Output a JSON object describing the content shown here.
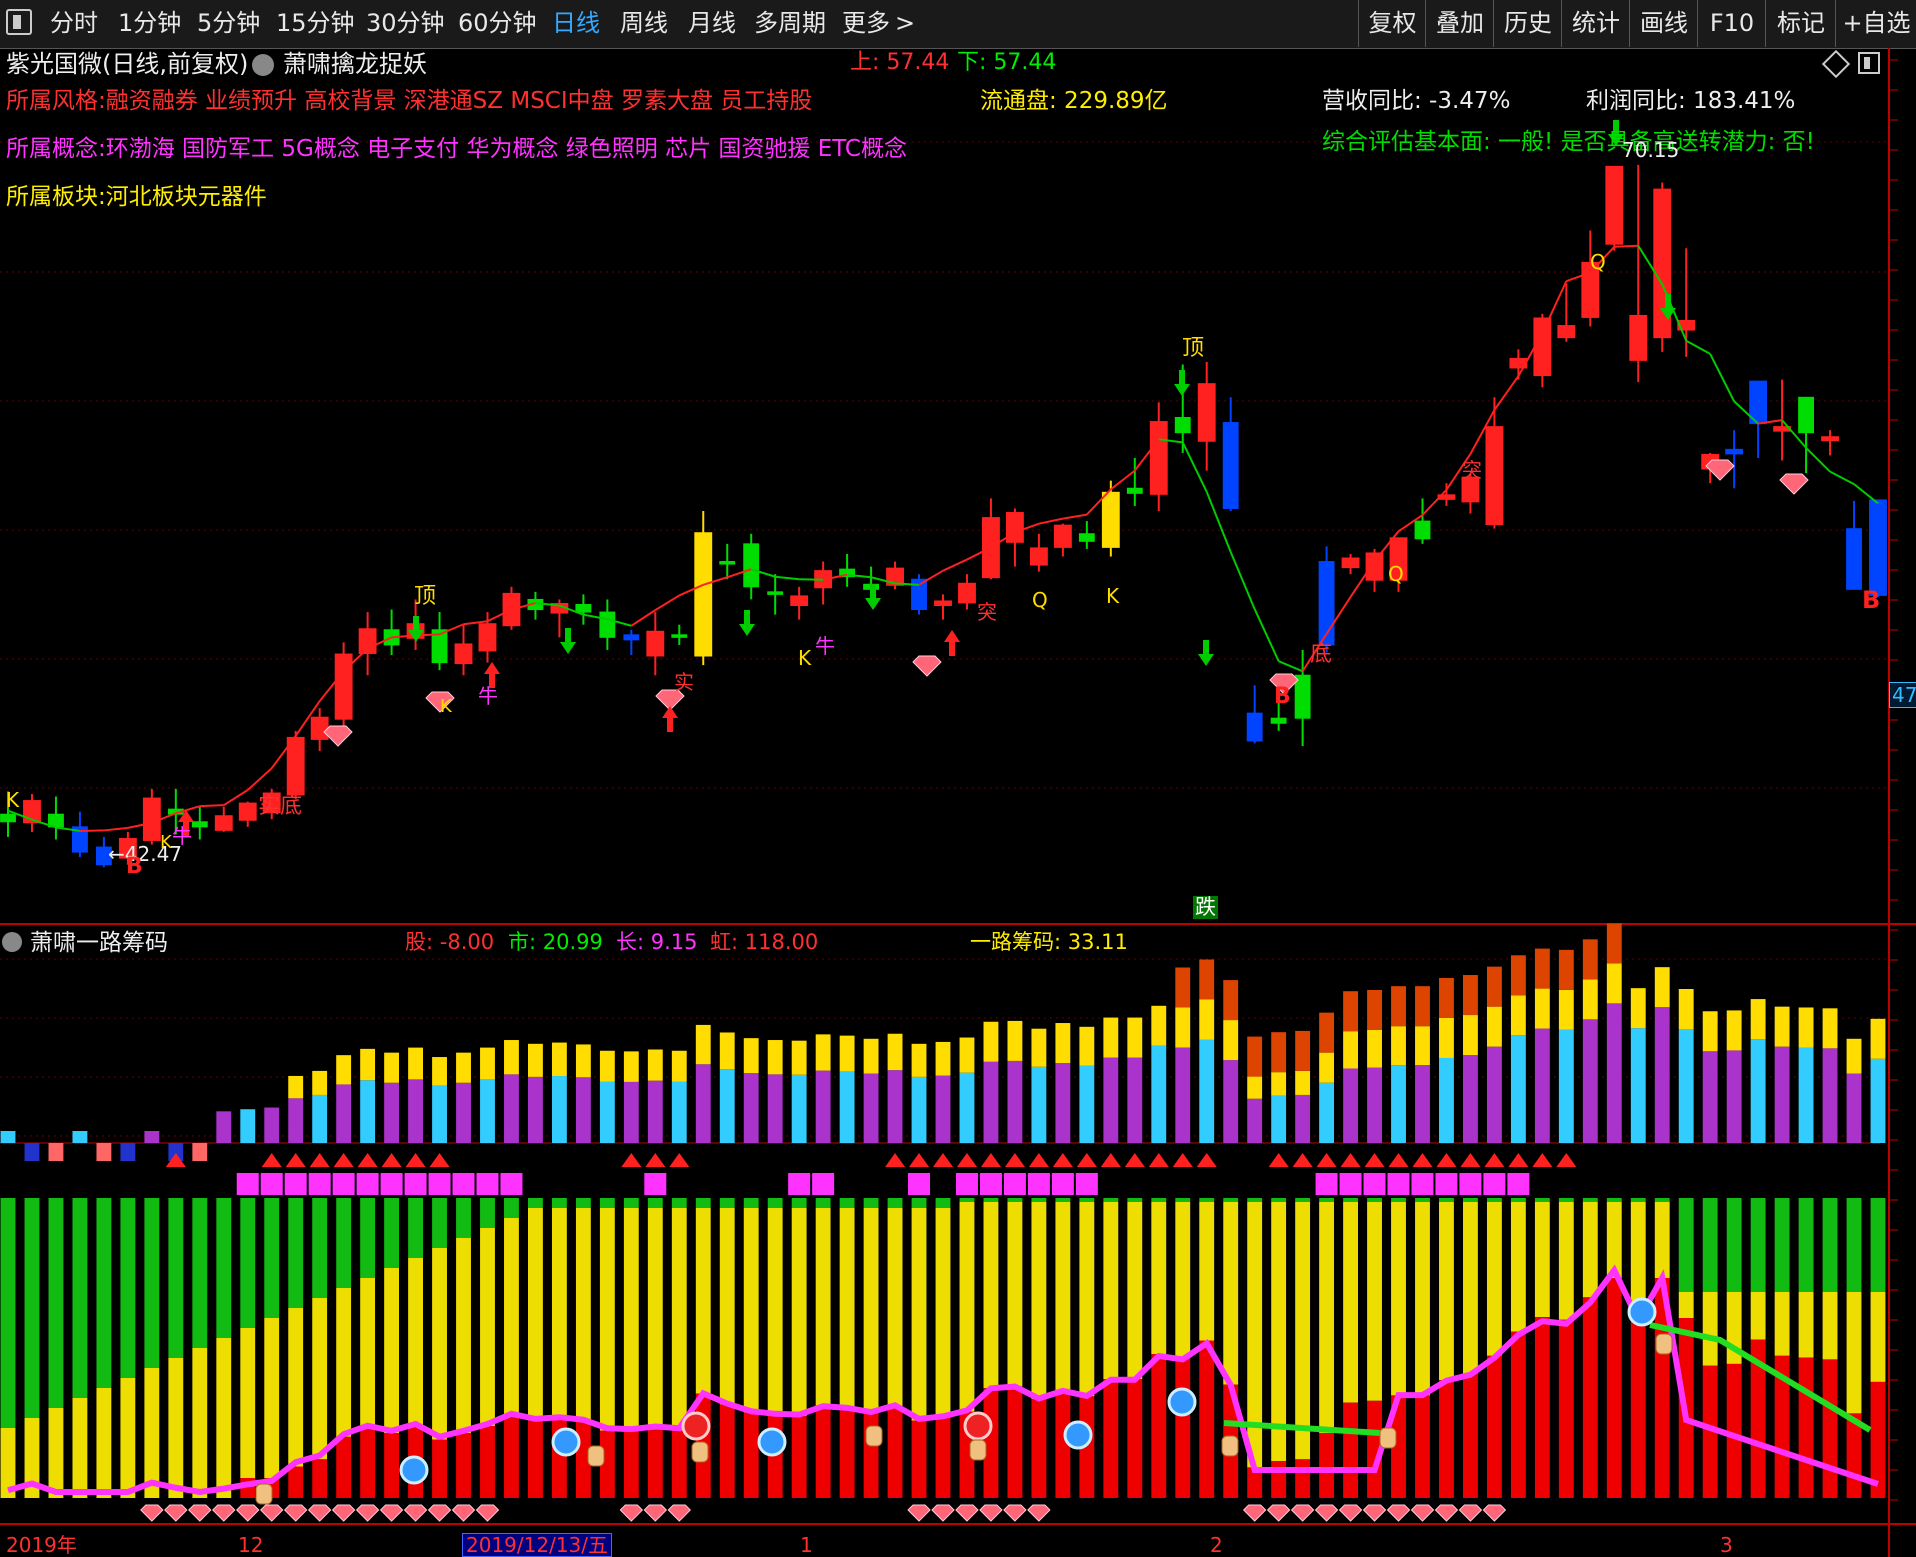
{
  "toolbar": {
    "menu_icon": "window-icon",
    "periods": [
      "分时",
      "1分钟",
      "5分钟",
      "15分钟",
      "30分钟",
      "60分钟",
      "日线",
      "周线",
      "月线",
      "多周期",
      "更多"
    ],
    "active_period": "日线",
    "more_arrow": ">",
    "right_buttons": [
      "复权",
      "叠加",
      "历史",
      "统计",
      "画线",
      "F10",
      "标记",
      "+自选"
    ]
  },
  "main_panel": {
    "title": "紫光国微(日线,前复权)",
    "indicator": "萧啸擒龙捉妖",
    "up_label": "上: 57.44",
    "down_label": "下: 57.44",
    "style_line": "所属风格:融资融券 业绩预升 高校背景 深港通SZ MSCI中盘 罗素大盘 员工持股",
    "concept_line": "所属概念:环渤海 国防军工 5G概念 电子支付 华为概念 绿色照明 芯片 国资驰援 ETC概念",
    "sector_line": "所属板块:河北板块元器件",
    "float_label": "流通盘: 229.89亿",
    "revenue_yoy": "营收同比: -3.47%",
    "profit_yoy": "利润同比: 183.41%",
    "assessment": "综合评估基本面: 一般! 是否具备高送转潜力: 否!",
    "price_high": "70.15",
    "price_low": "42.47",
    "price_axis_badge": "47",
    "fall_badge": "跌",
    "signal_labels": [
      "K",
      "实底",
      "K",
      "牛",
      "顶",
      "K",
      "牛",
      "实",
      "K",
      "牛",
      "突",
      "Q",
      "K",
      "顶",
      "底",
      "Q",
      "突",
      "Q",
      "B",
      "B",
      "B"
    ],
    "diamond_icon": "diamond-icon",
    "arrow_up_icon": "red-up-arrow-icon",
    "arrow_down_icon": "green-down-arrow-icon"
  },
  "sub_panel": {
    "indicator": "萧啸一路筹码",
    "stock_label": "股: -8.00",
    "market_label": "市: 20.99",
    "long_label": "长: 9.15",
    "rainbow_label": "虹: 118.00",
    "chip_label": "一路筹码: 33.11"
  },
  "time_axis": {
    "labels": [
      "2019年",
      "12",
      "2019/12/13/五",
      "1",
      "2",
      "3"
    ],
    "selected": "2019/12/13/五"
  },
  "colors": {
    "up": "#ff2020",
    "down_green": "#00dd00",
    "down_blue": "#0044ff",
    "yellow": "#ffdd00",
    "magenta": "#ff00ff",
    "cyan": "#33ccff",
    "purple": "#aa33cc",
    "axis": "#c00000"
  },
  "chart_data": {
    "type": "candlestick",
    "title": "紫光国微(日线,前复权)",
    "series": [
      {
        "name": "萧啸擒龙捉妖",
        "values": [
          [
            44.5,
            45.4,
            43.6,
            44.2
          ],
          [
            44.2,
            45.3,
            43.8,
            45.0
          ],
          [
            44.5,
            45.2,
            43.5,
            44.0
          ],
          [
            44.0,
            44.6,
            42.8,
            43.0
          ],
          [
            43.2,
            43.6,
            42.4,
            42.5
          ],
          [
            42.8,
            43.8,
            42.5,
            43.5
          ],
          [
            43.5,
            45.5,
            43.3,
            45.1
          ],
          [
            44.7,
            45.5,
            43.7,
            44.5
          ],
          [
            44.2,
            44.8,
            43.5,
            44.0
          ],
          [
            43.9,
            44.8,
            43.8,
            44.4
          ],
          [
            44.3,
            45.0,
            44.0,
            44.9
          ],
          [
            44.6,
            45.5,
            44.3,
            45.3
          ],
          [
            45.3,
            47.8,
            45.1,
            47.5
          ],
          [
            47.5,
            48.7,
            47.0,
            48.3
          ],
          [
            48.3,
            51.3,
            48.0,
            50.8
          ],
          [
            50.9,
            52.5,
            50.0,
            51.8
          ],
          [
            51.8,
            52.6,
            50.8,
            51.2
          ],
          [
            51.5,
            53.0,
            51.0,
            52.0
          ],
          [
            51.8,
            52.5,
            50.2,
            50.5
          ],
          [
            50.5,
            52.0,
            50.0,
            51.2
          ],
          [
            51.0,
            52.5,
            50.5,
            52.0
          ],
          [
            52.0,
            53.5,
            51.8,
            53.2
          ],
          [
            53.0,
            53.3,
            52.2,
            52.6
          ],
          [
            52.5,
            53.0,
            51.5,
            52.8
          ],
          [
            52.8,
            53.2,
            52.0,
            52.5
          ],
          [
            52.5,
            53.0,
            51.0,
            51.5
          ],
          [
            51.6,
            51.8,
            50.8,
            51.4
          ],
          [
            50.8,
            52.5,
            50.0,
            51.7
          ],
          [
            51.6,
            52.0,
            51.2,
            51.5
          ],
          [
            50.8,
            56.5,
            50.4,
            55.6
          ],
          [
            54.5,
            55.2,
            53.8,
            54.4
          ],
          [
            55.2,
            55.6,
            53.0,
            53.5
          ],
          [
            53.3,
            54.0,
            52.4,
            53.2
          ],
          [
            52.8,
            53.5,
            52.2,
            53.1
          ],
          [
            53.5,
            54.5,
            52.8,
            54.1
          ],
          [
            54.2,
            54.8,
            53.5,
            53.9
          ],
          [
            53.6,
            54.3,
            53.0,
            53.4
          ],
          [
            53.6,
            54.5,
            53.4,
            54.2
          ],
          [
            53.8,
            54.0,
            52.4,
            52.6
          ],
          [
            52.8,
            53.2,
            52.2,
            52.9
          ],
          [
            52.9,
            54.0,
            52.6,
            53.6
          ],
          [
            53.9,
            57.0,
            53.8,
            56.2
          ],
          [
            55.3,
            56.6,
            54.3,
            56.4
          ],
          [
            54.4,
            55.6,
            54.1,
            55.0
          ],
          [
            55.1,
            56.0,
            54.7,
            55.9
          ],
          [
            55.6,
            56.1,
            55.0,
            55.3
          ],
          [
            55.1,
            57.7,
            54.7,
            57.2
          ],
          [
            57.4,
            58.6,
            56.7,
            57.2
          ],
          [
            57.2,
            60.8,
            56.5,
            60.0
          ],
          [
            60.2,
            62.3,
            58.8,
            59.6
          ],
          [
            59.3,
            62.4,
            58.1,
            61.5
          ],
          [
            60.0,
            61.0,
            56.5,
            56.6
          ],
          [
            48.5,
            49.6,
            47.3,
            47.4
          ],
          [
            48.3,
            49.0,
            47.8,
            48.1
          ],
          [
            50.0,
            51.0,
            47.2,
            48.3
          ],
          [
            54.5,
            55.1,
            50.9,
            51.2
          ],
          [
            54.3,
            54.8,
            54.0,
            54.6
          ],
          [
            53.8,
            55.0,
            53.3,
            54.8
          ],
          [
            53.8,
            55.3,
            53.3,
            55.4
          ],
          [
            56.1,
            57.0,
            55.2,
            55.4
          ],
          [
            57.0,
            57.6,
            56.7,
            57.1
          ],
          [
            56.9,
            58.0,
            56.4,
            57.8
          ],
          [
            56.0,
            61.0,
            55.8,
            59.8
          ],
          [
            62.2,
            62.9,
            61.7,
            62.5
          ],
          [
            61.9,
            64.3,
            61.4,
            64.1
          ],
          [
            63.4,
            65.5,
            63.2,
            63.8
          ],
          [
            64.2,
            67.6,
            63.8,
            66.3
          ],
          [
            67.1,
            70.0,
            66.8,
            70.1
          ],
          [
            62.5,
            70.2,
            61.6,
            64.2
          ],
          [
            63.4,
            69.5,
            62.8,
            69.2
          ],
          [
            63.7,
            66.9,
            62.6,
            64.0
          ],
          [
            58.2,
            58.8,
            57.6,
            58.7
          ],
          [
            58.8,
            59.7,
            57.4,
            58.9
          ],
          [
            60.0,
            61.3,
            58.6,
            61.6
          ],
          [
            59.7,
            61.7,
            58.5,
            59.8
          ],
          [
            61.0,
            60.2,
            58.0,
            59.6
          ],
          [
            59.4,
            59.7,
            58.7,
            59.4
          ],
          [
            55.8,
            56.9,
            53.4,
            53.4
          ],
          [
            53.2,
            56.9,
            53.1,
            56.9
          ]
        ]
      }
    ],
    "price_labels": [
      42.47,
      70.15
    ],
    "sub_chart": {
      "name": "萧啸一路筹码",
      "stock": -8.0,
      "market": 20.99,
      "long": 9.15,
      "rainbow": 118.0,
      "chip": 33.11
    }
  }
}
